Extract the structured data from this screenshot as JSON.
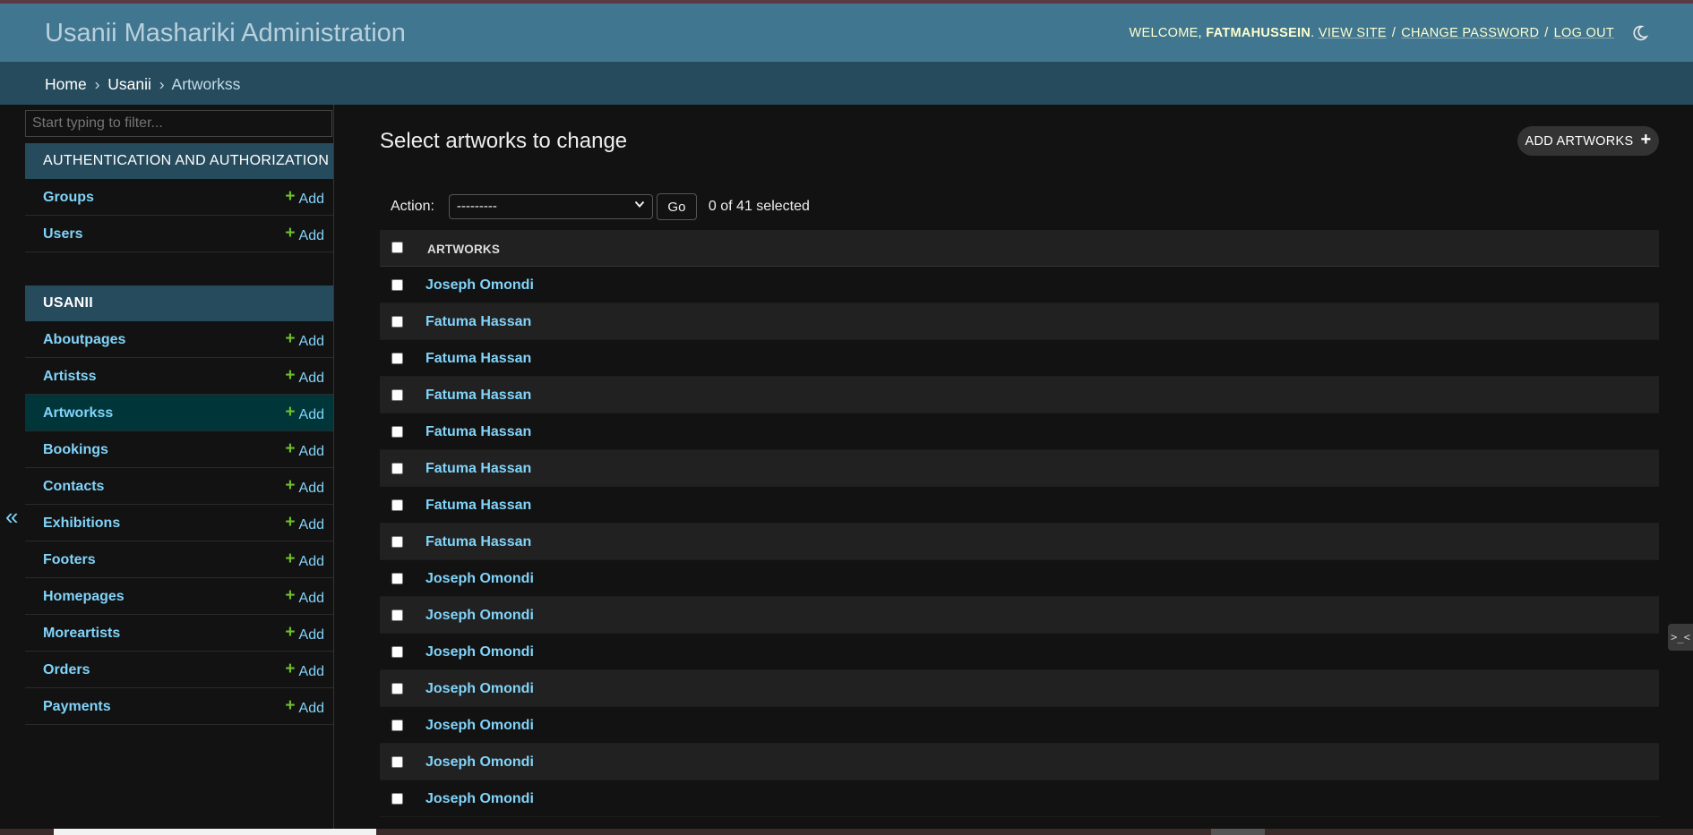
{
  "header": {
    "brand": "Usanii Mashariki Administration",
    "welcome": "Welcome,",
    "username": "FATMAHUSSEIN",
    "view_site": "View site",
    "change_password": "Change password",
    "log_out": "Log out",
    "theme_icon": "moon-icon"
  },
  "breadcrumbs": {
    "home": "Home",
    "app": "Usanii",
    "model": "Artworkss",
    "separator": "›"
  },
  "sidebar": {
    "filter_placeholder": "Start typing to filter...",
    "add_label": "Add",
    "auth": {
      "caption": "Authentication and Authorization",
      "items": [
        {
          "name": "Groups"
        },
        {
          "name": "Users"
        }
      ]
    },
    "usanii": {
      "caption": "Usanii",
      "items": [
        {
          "name": "Aboutpages"
        },
        {
          "name": "Artistss"
        },
        {
          "name": "Artworkss",
          "current": true
        },
        {
          "name": "Bookings"
        },
        {
          "name": "Contacts"
        },
        {
          "name": "Exhibitions"
        },
        {
          "name": "Footers"
        },
        {
          "name": "Homepages"
        },
        {
          "name": "Moreartists"
        },
        {
          "name": "Orders"
        },
        {
          "name": "Payments"
        }
      ]
    },
    "collapse_glyph": "«"
  },
  "content": {
    "title": "Select artworks to change",
    "add_button": "Add Artworks",
    "action_label": "Action:",
    "action_selected": "---------",
    "go_label": "Go",
    "counter": "0 of 41 selected",
    "column_header": "Artworks",
    "rows": [
      "Joseph Omondi",
      "Fatuma Hassan",
      "Fatuma Hassan",
      "Fatuma Hassan",
      "Fatuma Hassan",
      "Fatuma Hassan",
      "Fatuma Hassan",
      "Fatuma Hassan",
      "Joseph Omondi",
      "Joseph Omondi",
      "Joseph Omondi",
      "Joseph Omondi",
      "Joseph Omondi",
      "Joseph Omondi",
      "Joseph Omondi"
    ]
  },
  "colors": {
    "header": "#417690",
    "breadcrumbs": "#264b5d",
    "link": "#81d4fa",
    "accent_plus": "#70bf2b",
    "current_row": "#00363a",
    "background": "#121212"
  },
  "side_fab": ">_<"
}
